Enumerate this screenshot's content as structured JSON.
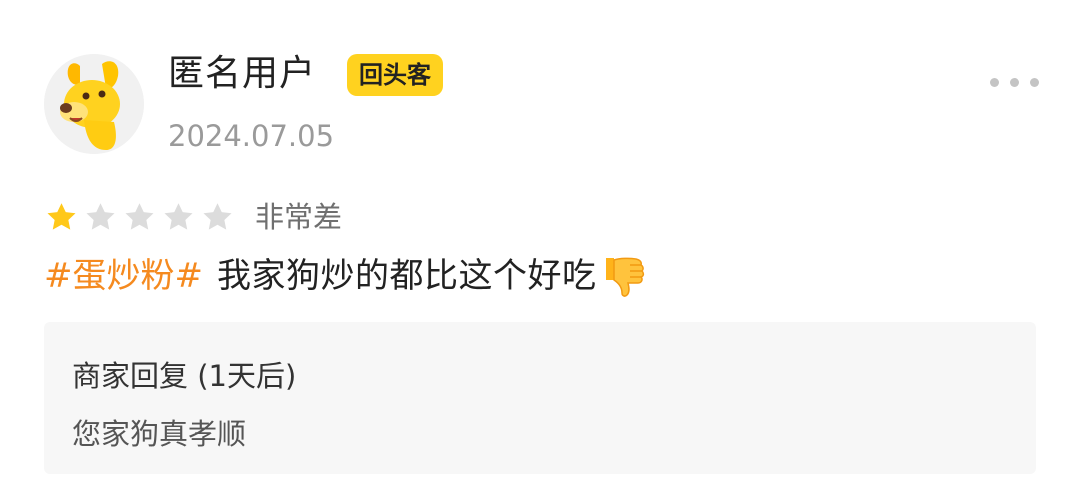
{
  "review": {
    "user": {
      "name": "匿名用户",
      "badge": "回头客",
      "avatar_icon": "yellow-dog-icon"
    },
    "date": "2024.07.05",
    "more_icon": "more-dots-icon",
    "rating": {
      "stars_filled": 1,
      "stars_total": 5,
      "label": "非常差",
      "star_color": "#ffc81a",
      "star_empty_color": "#dcdcdc"
    },
    "hashtag": "#蛋炒粉#",
    "text": "我家狗炒的都比这个好吃",
    "emoji_icon": "thumbs-down-icon",
    "merchant_reply": {
      "title": "商家回复 (1天后)",
      "text": "您家狗真孝顺"
    }
  },
  "colors": {
    "badge_bg": "#ffd21f",
    "hashtag": "#f58a1f",
    "reply_bg": "#f7f7f7",
    "date": "#9a9a9a"
  }
}
